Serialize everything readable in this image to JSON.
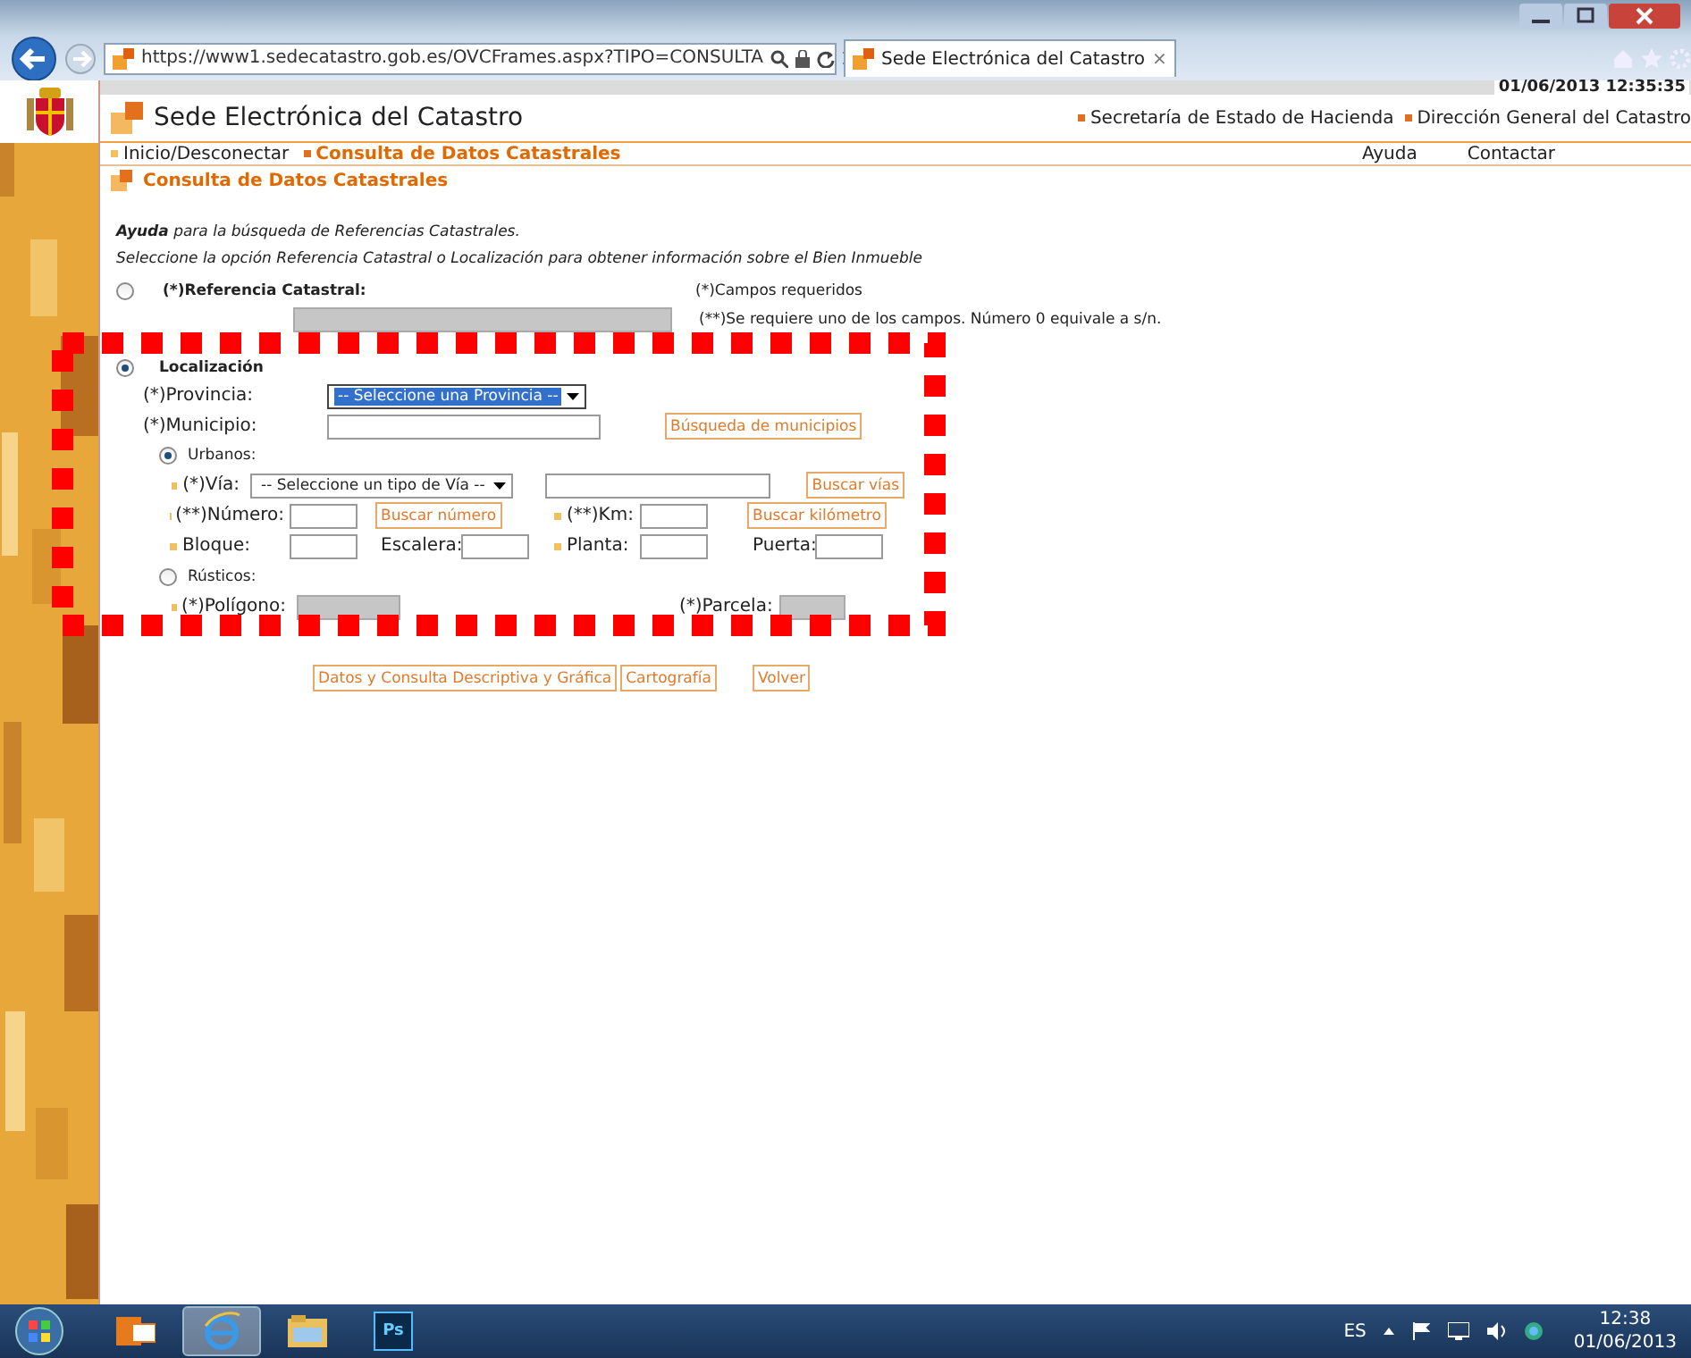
{
  "browser": {
    "address": "https://www1.sedecatastro.gob.es/OVCFrames.aspx?TIPO=CONSULTA",
    "tabs": [
      {
        "label": "Sede Electrónica del Catastro",
        "selected": true,
        "close": "×"
      }
    ]
  },
  "header": {
    "datetime": "01/06/2013 12:35:35",
    "site_title": "Sede Electrónica del Catastro",
    "links": [
      "Secretaría de Estado de Hacienda",
      "Dirección General del Catastro"
    ]
  },
  "nav": {
    "breadcrumbs": [
      {
        "label": "Inicio/Desconectar",
        "current": false
      },
      {
        "label": "Consulta de Datos Catastrales",
        "current": true
      }
    ],
    "links": [
      "Ayuda",
      "Contactar"
    ]
  },
  "page_title": "Consulta de Datos Catastrales",
  "help": [
    "**Ayuda** para la búsqueda de Referencias Catastrales.",
    "Seleccione la opción Referencia Catastral o Localización para obtener información sobre el Bien Inmueble"
  ],
  "referencia": {
    "label": "(*)Referencia Catastral:",
    "selected": false,
    "field_disabled": true
  },
  "notes": [
    "(*)Campos requeridos",
    "(**)Se requiere uno de los campos. Número 0 equivale a s/n."
  ],
  "localizacion": {
    "label": "Localización",
    "selected": true,
    "provincia": {
      "label": "(*)Provincia:",
      "value": "-- Seleccione una Provincia --",
      "focused": true
    },
    "municipio": {
      "label": "(*)Municipio:",
      "button": "Búsqueda de municipios"
    },
    "urbanos": {
      "label": "Urbanos:",
      "selected": true,
      "via": {
        "label": "(*)Vía:",
        "value": "-- Seleccione un tipo de Vía --",
        "button": "Buscar vías"
      },
      "rows": [
        [
          {
            "label": "(**)Número:"
          },
          {
            "button": "Buscar número"
          },
          {
            "label": "(**)Km:"
          },
          {
            "button": "Buscar kilómetro"
          }
        ],
        [
          {
            "label": "Bloque:"
          },
          {
            "label": "Escalera:"
          },
          {
            "label": "Planta:"
          },
          {
            "label": "Puerta:"
          }
        ]
      ]
    },
    "rusticos": {
      "label": "Rústicos:",
      "selected": false,
      "fields": [
        {
          "label": "(*)Polígono:",
          "disabled": true
        },
        {
          "label": "(*)Parcela:",
          "disabled": true
        }
      ]
    }
  },
  "actions": [
    "Datos y Consulta Descriptiva y Gráfica",
    "Cartografía",
    "Volver"
  ],
  "taskbar": {
    "apps": [
      {
        "kind": "mail",
        "selected": false
      },
      {
        "kind": "browser",
        "selected": true
      },
      {
        "kind": "folder",
        "selected": false
      },
      {
        "kind": "photoshop",
        "label": "Ps",
        "selected": false
      }
    ],
    "language": "ES",
    "time": "12:38",
    "date": "01/06/2013"
  }
}
